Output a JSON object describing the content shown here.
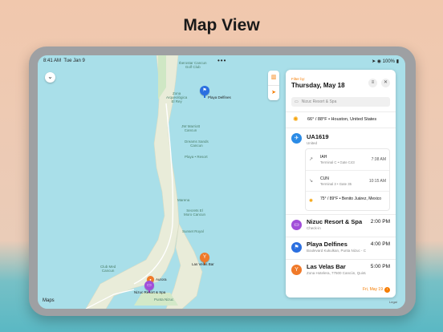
{
  "headline": "Map View",
  "colors": {
    "accent": "#f57c00",
    "flight": "#2b8be6",
    "hotel": "#a14ed9",
    "beach": "#2b6fe0",
    "bar": "#f07a2a"
  },
  "statusbar": {
    "time": "8:41 AM",
    "date": "Tue Jan 9",
    "dots": "•••",
    "battery": "100%"
  },
  "map": {
    "collapse_icon": "chevron-down-icon",
    "controls": [
      "map-icon",
      "location-arrow-icon"
    ],
    "attribution": "Maps",
    "legal": "Legal",
    "labels": {
      "golf": "Iberostar Cancun\nGolf Club",
      "zona_arq": "Zona\nArqueológica\nEl Rey",
      "marriott": "JW Marriott\nCancun",
      "dreams": "Dreams Sands\nCancun",
      "playa_resort": "Playa • Resort",
      "marena": "Marena",
      "secrets": "Secrets El\nMoro Cancun",
      "sunset": "Sunset Royal",
      "club_med": "Club Med\nCancun",
      "punta_nizuc": "Punta Nizuc",
      "aurora": "Aurora",
      "hotel_pin": "Nizuc Resort & Spa",
      "bar_pin": "Las Velas Bar",
      "beach_pin": "Playa Delfines",
      "playa_label": "Playa Delfines"
    }
  },
  "panel": {
    "filter_label": "Filter by:",
    "filter_date": "Thursday, May 18",
    "search_placeholder": "Nizuc Resort & Spa",
    "weather": "66° / 88°F • Houston, United States",
    "flight": {
      "code": "UA1619",
      "airline": "United"
    },
    "segments": [
      {
        "code": "IAH",
        "detail": "Terminal C • Gate C43",
        "time": "7:38 AM",
        "icon": "departure-icon"
      },
      {
        "code": "CUN",
        "detail": "Terminal 3 • Gate 35",
        "time": "10:15 AM",
        "icon": "arrival-icon"
      },
      {
        "code": "75° / 89°F • Benito Juárez, Mexico",
        "detail": "",
        "time": "",
        "icon": "sun-icon"
      }
    ],
    "items": [
      {
        "title": "Nizuc Resort & Spa",
        "sub": "Check-in",
        "time": "2:00 PM",
        "icon": "bed-icon"
      },
      {
        "title": "Playa Delfines",
        "sub": "Boulevard Kukulkan, Punta Nizuc - Cancún",
        "time": "4:00 PM",
        "icon": "flag-icon"
      },
      {
        "title": "Las Velas Bar",
        "sub": "Zona Hotelera, 77500 Cancún, Quintana...",
        "time": "5:00 PM",
        "icon": "cocktail-icon"
      }
    ],
    "next_day": "Fri, May 19"
  }
}
